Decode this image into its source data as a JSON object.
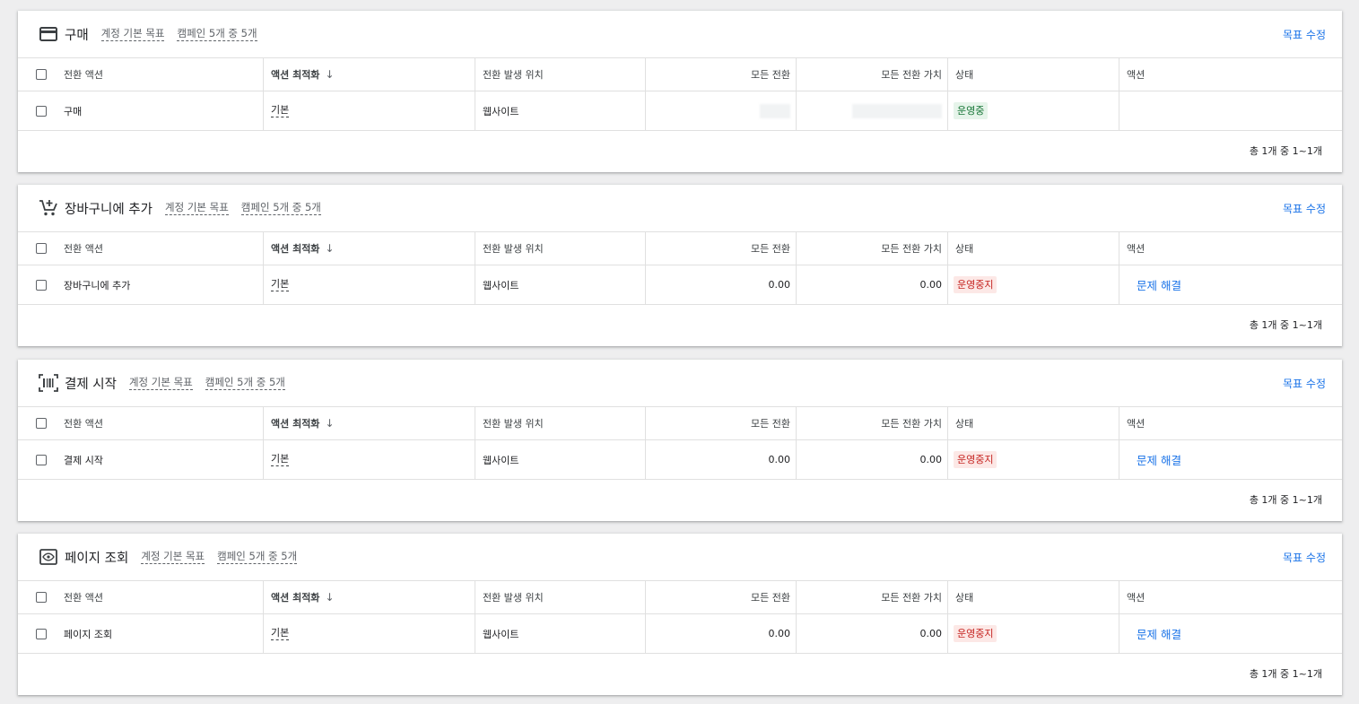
{
  "table_headers": {
    "action": "전환 액션",
    "optimization": "액션 최적화",
    "source": "전환 발생 위치",
    "all_conv": "모든 전환",
    "all_conv_value": "모든 전환 가치",
    "status": "상태",
    "actions": "액션"
  },
  "edit_goal_label": "목표 수정",
  "pager_text": "총 1개 중 1~1개",
  "colors": {
    "link": "#1a73e8",
    "active_bg": "#e6f4ea",
    "active_fg": "#137333",
    "paused_bg": "#fce8e6",
    "paused_fg": "#c5221f"
  },
  "goals": [
    {
      "icon": "credit-card-icon",
      "title": "구매",
      "default_goal": "계정 기본 목표",
      "campaigns": "캠페인 5개 중 5개",
      "row": {
        "name": "구매",
        "optimization": "기본",
        "source": "웹사이트",
        "all_conv": "",
        "all_conv_value": "",
        "status": "운영중",
        "action": ""
      }
    },
    {
      "icon": "add-shopping-cart-icon",
      "title": "장바구니에 추가",
      "default_goal": "계정 기본 목표",
      "campaigns": "캠페인 5개 중 5개",
      "row": {
        "name": "장바구니에 추가",
        "optimization": "기본",
        "source": "웹사이트",
        "all_conv": "0.00",
        "all_conv_value": "0.00",
        "status": "운영중지",
        "action": "문제 해결"
      }
    },
    {
      "icon": "barcode-scanner-icon",
      "title": "결제 시작",
      "default_goal": "계정 기본 목표",
      "campaigns": "캠페인 5개 중 5개",
      "row": {
        "name": "결제 시작",
        "optimization": "기본",
        "source": "웹사이트",
        "all_conv": "0.00",
        "all_conv_value": "0.00",
        "status": "운영중지",
        "action": "문제 해결"
      }
    },
    {
      "icon": "page-view-icon",
      "title": "페이지 조회",
      "default_goal": "계정 기본 목표",
      "campaigns": "캠페인 5개 중 5개",
      "row": {
        "name": "페이지 조회",
        "optimization": "기본",
        "source": "웹사이트",
        "all_conv": "0.00",
        "all_conv_value": "0.00",
        "status": "운영중지",
        "action": "문제 해결"
      }
    }
  ]
}
